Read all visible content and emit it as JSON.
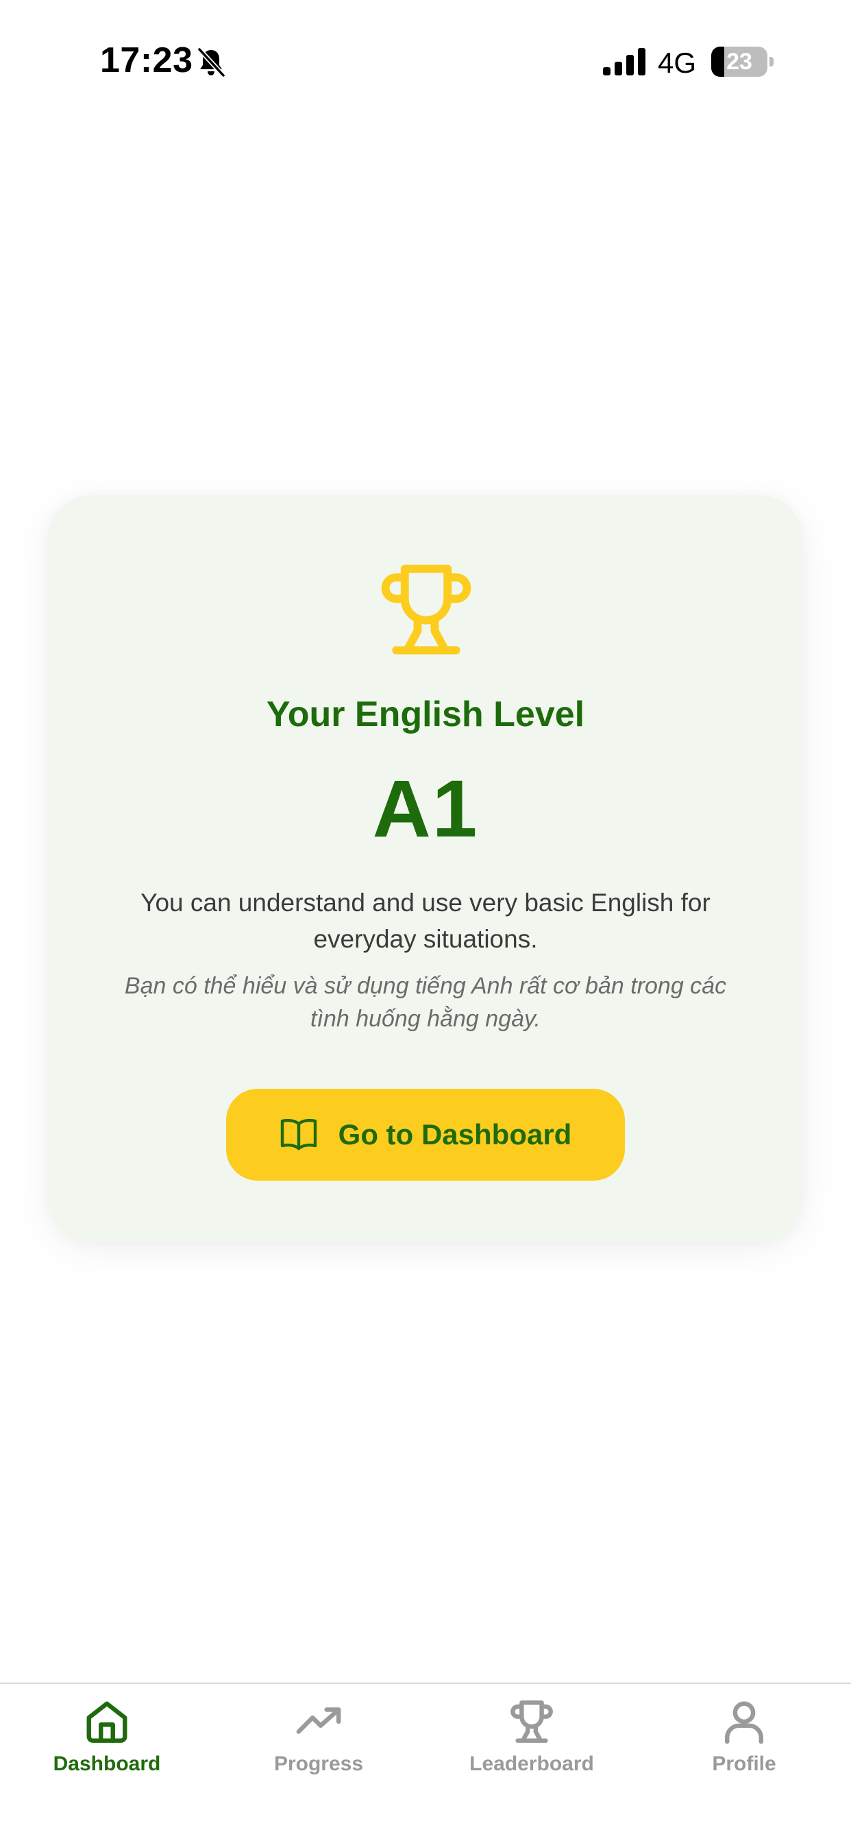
{
  "status_bar": {
    "time": "17:23",
    "network": "4G",
    "battery_percent": "23",
    "battery_level": 0.23,
    "icons": [
      "bell-muted-icon",
      "cellular-signal-icon",
      "battery-icon"
    ]
  },
  "result_card": {
    "icon": "trophy-icon",
    "title": "Your English Level",
    "level": "A1",
    "description_en": "You can understand and use very basic English for everyday situations.",
    "description_vi": "Bạn có thể hiểu và sử dụng tiếng Anh rất cơ bản trong các tình huống hằng ngày.",
    "button": {
      "label": "Go to Dashboard",
      "icon": "book-open-icon"
    }
  },
  "bottom_nav": {
    "active": "Dashboard",
    "items": [
      {
        "label": "Dashboard",
        "icon": "home-icon"
      },
      {
        "label": "Progress",
        "icon": "trending-up-icon"
      },
      {
        "label": "Leaderboard",
        "icon": "trophy-icon"
      },
      {
        "label": "Profile",
        "icon": "user-icon"
      }
    ]
  },
  "colors": {
    "primary_green": "#1e6b0b",
    "accent_yellow": "#fccd1f",
    "card_background": "#f1f7ef",
    "inactive_gray": "#9a9a9a"
  }
}
